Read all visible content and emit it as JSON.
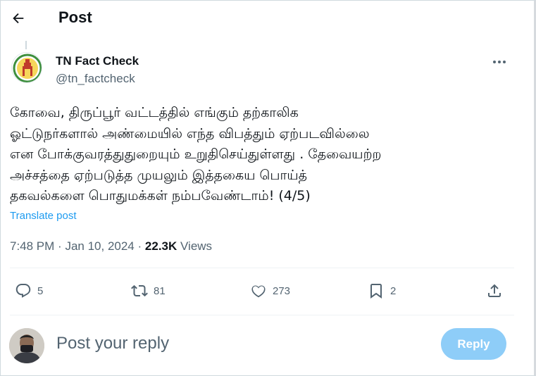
{
  "header": {
    "title": "Post"
  },
  "author": {
    "name": "TN Fact Check",
    "handle": "@tn_factcheck"
  },
  "post": {
    "text": "கோவை, திருப்பூர் வட்டத்தில் எங்கும் தற்காலிக\nஓட்டுநர்களால் அண்மையில் எந்த விபத்தும் ஏற்படவில்லை\nஎன போக்குவரத்துதுறையும் உறுதிசெய்துள்ளது . தேவையற்ற\nஅச்சத்தை ஏற்படுத்த முயலும் இத்தகைய பொய்த்\nதகவல்களை பொதுமக்கள் நம்பவேண்டாம்!  (4/5)",
    "translate_label": "Translate post"
  },
  "meta": {
    "time": "7:48 PM",
    "date": "Jan 10, 2024",
    "separator": "·",
    "views_count": "22.3K",
    "views_label": "Views"
  },
  "actions": {
    "replies": "5",
    "reposts": "81",
    "likes": "273",
    "bookmarks": "2"
  },
  "reply": {
    "placeholder": "Post your reply",
    "button_label": "Reply"
  },
  "colors": {
    "accent": "#1d9bf0",
    "reply_button": "#8ecdf8",
    "muted_text": "#536471",
    "text": "#0f1419"
  },
  "icons": [
    "back-arrow-icon",
    "more-icon",
    "reply-icon",
    "repost-icon",
    "like-icon",
    "bookmark-icon",
    "share-icon"
  ]
}
